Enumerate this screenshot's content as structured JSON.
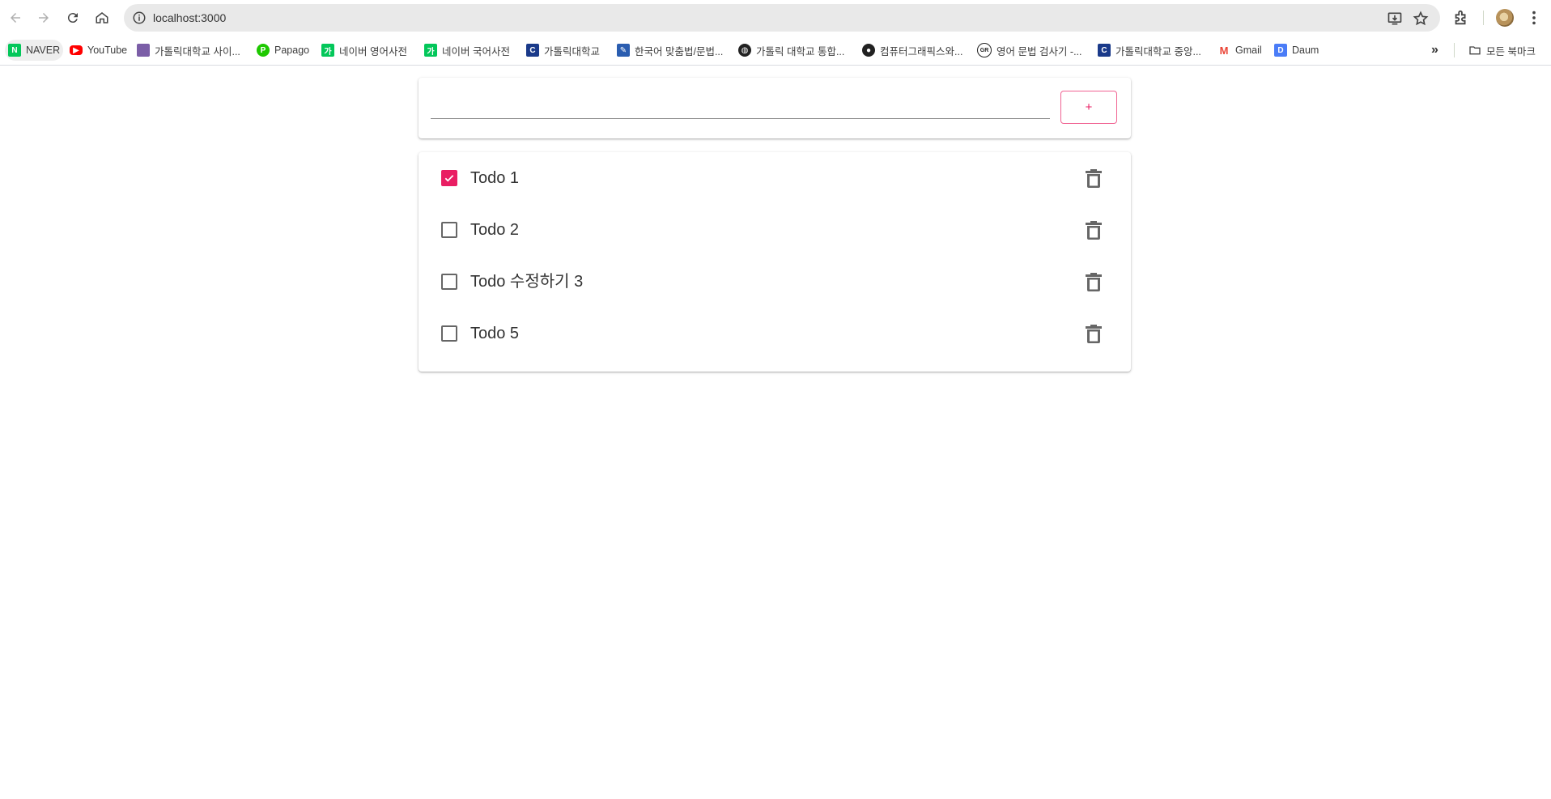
{
  "browser": {
    "url": "localhost:3000",
    "bookmarks": [
      {
        "label": "NAVER",
        "icon": "naver-icon",
        "color": "#03c75a"
      },
      {
        "label": "YouTube",
        "icon": "youtube-icon",
        "color": "#ff0000"
      },
      {
        "label": "가톨릭대학교 사이...",
        "icon": "catholic-univ-icon",
        "color": "#7b5ea7"
      },
      {
        "label": "Papago",
        "icon": "papago-icon",
        "color": "#1ec800"
      },
      {
        "label": "네이버 영어사전",
        "icon": "naver-dict-icon",
        "color": "#03c75a"
      },
      {
        "label": "네이버 국어사전",
        "icon": "naver-dict-icon",
        "color": "#03c75a"
      },
      {
        "label": "가톨릭대학교",
        "icon": "cuk-icon",
        "color": "#1a3a8a"
      },
      {
        "label": "한국어 맞춤법/문법...",
        "icon": "spellcheck-icon",
        "color": "#2a5db0"
      },
      {
        "label": "가톨릭 대학교 통합...",
        "icon": "globe-icon",
        "color": "#222222"
      },
      {
        "label": "컴퓨터그래픽스와...",
        "icon": "github-icon",
        "color": "#222222"
      },
      {
        "label": "영어 문법 검사기 -...",
        "icon": "grammar-icon",
        "color": "#222222"
      },
      {
        "label": "가톨릭대학교 중앙...",
        "icon": "cuk-icon",
        "color": "#1a3a8a"
      },
      {
        "label": "Gmail",
        "icon": "gmail-icon",
        "color": "#ea4335"
      },
      {
        "label": "Daum",
        "icon": "daum-icon",
        "color": "#4a7cf7"
      }
    ],
    "all_bookmarks_label": "모든 북마크"
  },
  "app": {
    "input": {
      "value": "",
      "placeholder": ""
    },
    "add_button_label": "+",
    "todos": [
      {
        "text": "Todo 1",
        "checked": true
      },
      {
        "text": "Todo 2",
        "checked": false
      },
      {
        "text": "Todo 수정하기 3",
        "checked": false
      },
      {
        "text": "Todo 5",
        "checked": false
      }
    ]
  },
  "colors": {
    "accent": "#e91e63"
  }
}
